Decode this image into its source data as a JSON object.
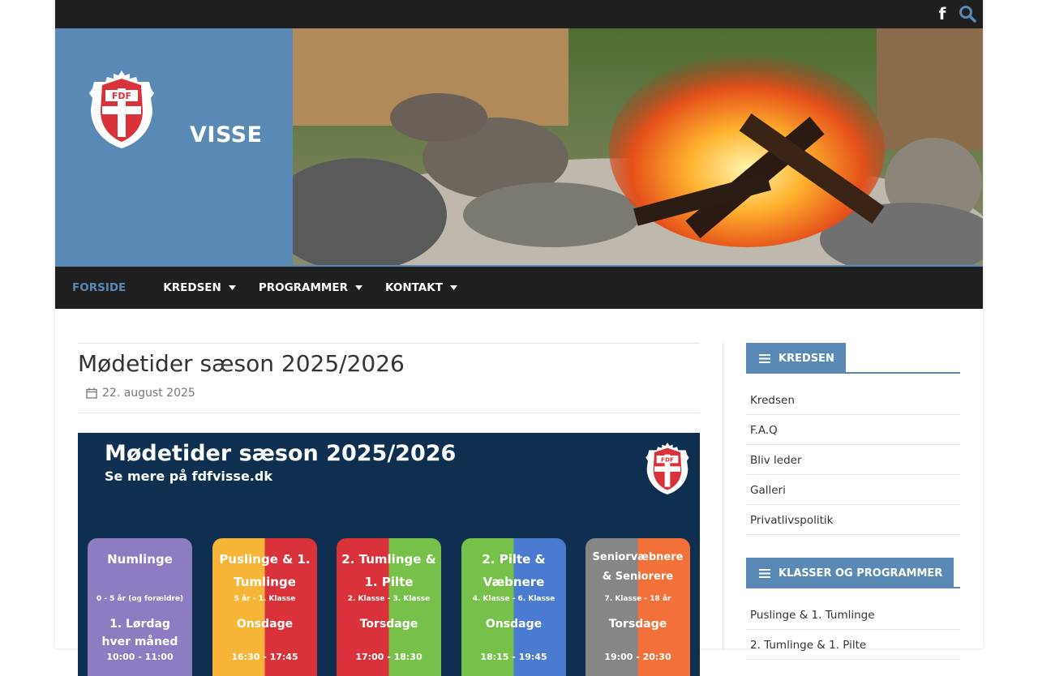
{
  "topbar": {
    "facebook_icon": "facebook-icon",
    "search_icon": "search-icon"
  },
  "header": {
    "site_title": "VISSE",
    "logo_text": "FDF"
  },
  "nav": {
    "items": [
      {
        "label": "FORSIDE"
      },
      {
        "label": "KREDSEN"
      },
      {
        "label": "PROGRAMMER"
      },
      {
        "label": "KONTAKT"
      }
    ]
  },
  "post": {
    "title": "Mødetider sæson 2025/2026",
    "date": "22. august 2025",
    "poster": {
      "title": "Mødetider sæson 2025/2026",
      "subtitle": "Se mere på fdfvisse.dk",
      "logo_text": "FDF",
      "cards": [
        {
          "title": "Numlinge",
          "sub": "0 - 5 år (og forældre)",
          "day1": "1. Lørdag",
          "day2": "hver måned",
          "time": "10:00 - 11:00",
          "color": "#8e7cc3"
        },
        {
          "title": "Puslinge & 1. Tumlinge",
          "sub": "5 år - 1. Klasse",
          "day1": "Onsdage",
          "day2": "",
          "time": "16:30 - 17:45",
          "color": "#f7b538"
        },
        {
          "title": "2. Tumlinge & 1. Pilte",
          "sub": "2. Klasse - 3. Klasse",
          "day1": "Torsdage",
          "day2": "",
          "time": "17:00 - 18:30",
          "color": "#d9323a"
        },
        {
          "title": "2. Pilte & Væbnere",
          "sub": "4. Klasse - 6. Klasse",
          "day1": "Onsdage",
          "day2": "",
          "time": "18:15 - 19:45",
          "color": "#77c04a"
        },
        {
          "title": "Seniorvæbnere & Seniorere",
          "sub": "7. Klasse - 18 år",
          "day1": "Torsdage",
          "day2": "",
          "time": "19:00 - 20:30",
          "color": "#868686"
        }
      ]
    }
  },
  "sidebar": {
    "widget1": {
      "title": "KREDSEN",
      "items": [
        "Kredsen",
        "F.A.Q",
        "Bliv leder",
        "Galleri",
        "Privatlivspolitik"
      ]
    },
    "widget2": {
      "title": "KLASSER OG PROGRAMMER",
      "items": [
        "Puslinge & 1. Tumlinge",
        "2. Tumlinge & 1. Pilte"
      ]
    }
  }
}
